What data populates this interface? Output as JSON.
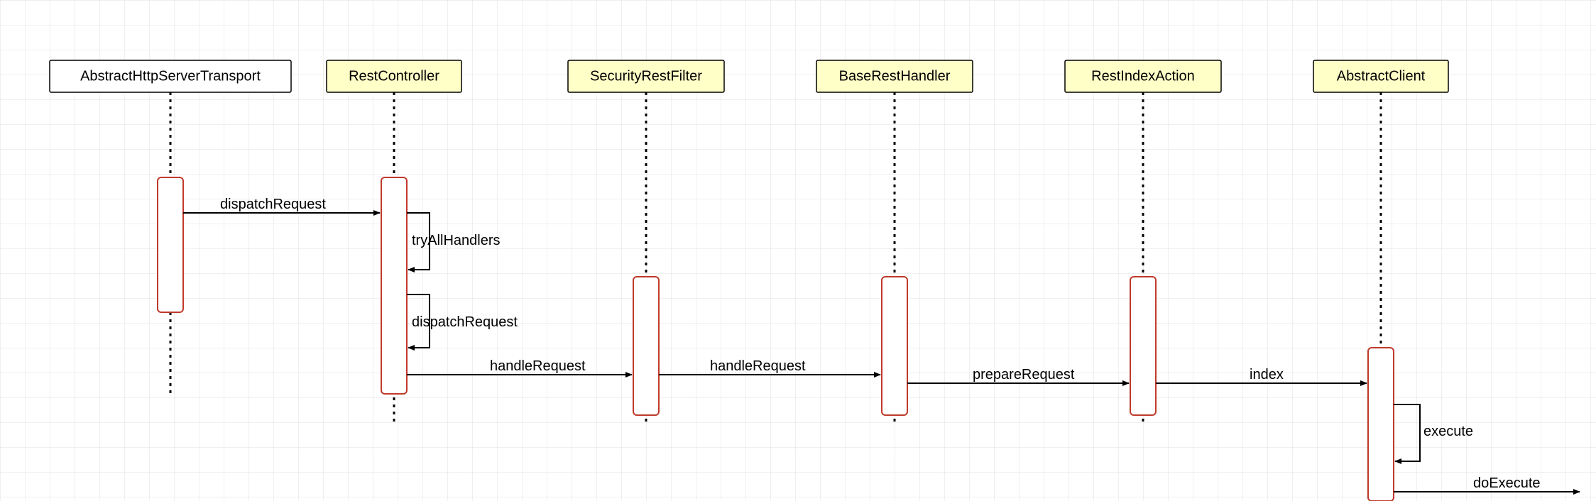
{
  "participants": {
    "p0": {
      "label": "AbstractHttpServerTransport",
      "highlight": false
    },
    "p1": {
      "label": "RestController",
      "highlight": true
    },
    "p2": {
      "label": "SecurityRestFilter",
      "highlight": true
    },
    "p3": {
      "label": "BaseRestHandler",
      "highlight": true
    },
    "p4": {
      "label": "RestIndexAction",
      "highlight": true
    },
    "p5": {
      "label": "AbstractClient",
      "highlight": true
    }
  },
  "messages": {
    "m0": "dispatchRequest",
    "m1": "tryAllHandlers",
    "m2": "dispatchRequest",
    "m3": "handleRequest",
    "m4": "handleRequest",
    "m5": "prepareRequest",
    "m6": "index",
    "m7": "execute",
    "m8": "doExecute"
  },
  "chart_data": {
    "type": "sequence-diagram",
    "participants": [
      "AbstractHttpServerTransport",
      "RestController",
      "SecurityRestFilter",
      "BaseRestHandler",
      "RestIndexAction",
      "AbstractClient"
    ],
    "messages": [
      {
        "from": "AbstractHttpServerTransport",
        "to": "RestController",
        "label": "dispatchRequest"
      },
      {
        "from": "RestController",
        "to": "RestController",
        "label": "tryAllHandlers"
      },
      {
        "from": "RestController",
        "to": "RestController",
        "label": "dispatchRequest"
      },
      {
        "from": "RestController",
        "to": "SecurityRestFilter",
        "label": "handleRequest"
      },
      {
        "from": "SecurityRestFilter",
        "to": "BaseRestHandler",
        "label": "handleRequest"
      },
      {
        "from": "BaseRestHandler",
        "to": "RestIndexAction",
        "label": "prepareRequest"
      },
      {
        "from": "RestIndexAction",
        "to": "AbstractClient",
        "label": "index"
      },
      {
        "from": "AbstractClient",
        "to": "AbstractClient",
        "label": "execute"
      },
      {
        "from": "AbstractClient",
        "to": "(external)",
        "label": "doExecute"
      }
    ]
  }
}
